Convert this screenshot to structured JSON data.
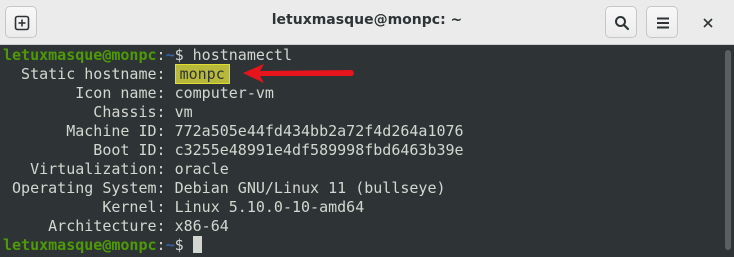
{
  "window": {
    "title": "letuxmasque@monpc: ~"
  },
  "terminal": {
    "command_line": {
      "user_host": "letuxmasque@monpc",
      "separator": ":",
      "path": "~",
      "symbol": "$",
      "command": " hostnamectl"
    },
    "rows": [
      {
        "label": "  Static hostname: ",
        "value": "monpc"
      },
      {
        "label": "        Icon name: ",
        "value": "computer-vm"
      },
      {
        "label": "          Chassis: ",
        "value": "vm"
      },
      {
        "label": "       Machine ID: ",
        "value": "772a505e44fd434bb2a72f4d264a1076"
      },
      {
        "label": "          Boot ID: ",
        "value": "c3255e48991e4df589998fbd6463b39e"
      },
      {
        "label": "   Virtualization: ",
        "value": "oracle"
      },
      {
        "label": " Operating System: ",
        "value": "Debian GNU/Linux 11 (bullseye)"
      },
      {
        "label": "           Kernel: ",
        "value": "Linux 5.10.0-10-amd64"
      },
      {
        "label": "     Architecture: ",
        "value": "x86-64"
      }
    ],
    "final_prompt": {
      "user_host": "letuxmasque@monpc",
      "separator": ":",
      "path": "~",
      "symbol": "$ "
    }
  },
  "icons": {
    "new_tab": "new-tab-icon",
    "search": "search-icon",
    "menu": "hamburger-menu-icon",
    "close": "close-icon",
    "annotation": "red-arrow-icon"
  },
  "colors": {
    "terminal_bg": "#2e3436",
    "prompt_user": "#4e9a06",
    "prompt_path": "#3465a4",
    "text": "#d3d7cf",
    "highlight_bg": "#b8b83a",
    "arrow": "#e8141c"
  }
}
